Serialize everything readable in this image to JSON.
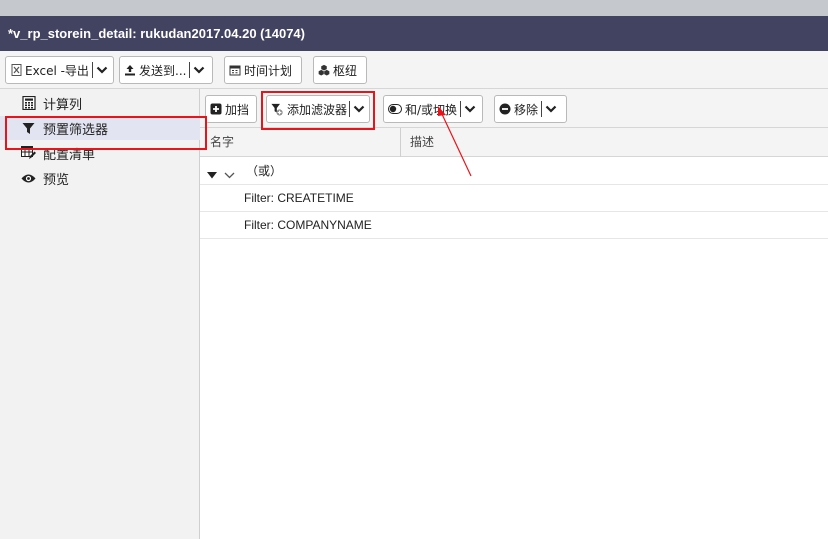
{
  "window": {
    "title": "*v_rp_storein_detail: rukudan2017.04.20 (14074)"
  },
  "toolbar": {
    "excel_label": "Excel -导出",
    "send_label": "发送到...",
    "schedule_label": "时间计划",
    "pivot_label": "枢纽"
  },
  "sidebar": {
    "items": [
      {
        "label": "计算列",
        "icon": "calculator-icon"
      },
      {
        "label": "预置筛选器",
        "icon": "filter-icon"
      },
      {
        "label": "配置清单",
        "icon": "table-edit-icon"
      },
      {
        "label": "预览",
        "icon": "eye-icon"
      }
    ]
  },
  "filters_toolbar": {
    "add_block_label": "加挡",
    "add_filter_label": "添加滤波器",
    "toggle_label": "和/或切换",
    "remove_label": "移除"
  },
  "table": {
    "columns": [
      "名字",
      "描述"
    ],
    "group_label": "（或）",
    "rows": [
      "Filter: CREATETIME",
      "Filter: COMPANYNAME"
    ]
  },
  "colors": {
    "titlebar": "#414360",
    "annotation": "#e8141b",
    "active_item": "#e3e4f1"
  }
}
